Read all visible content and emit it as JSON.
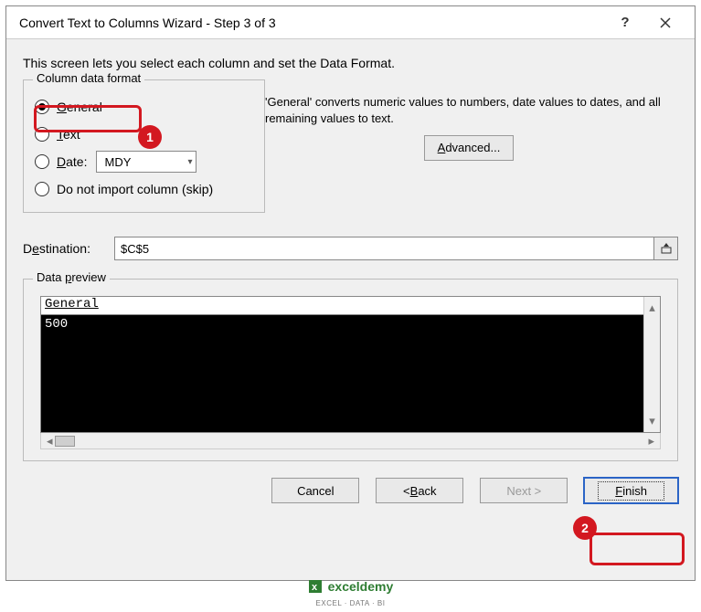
{
  "titlebar": {
    "title": "Convert Text to Columns Wizard - Step 3 of 3"
  },
  "instruction": "This screen lets you select each column and set the Data Format.",
  "format_group": {
    "label": "Column data format",
    "options": {
      "general": "General",
      "text": "Text",
      "date": "Date:",
      "skip": "Do not import column (skip)"
    },
    "date_value": "MDY",
    "description": "'General' converts numeric values to numbers, date values to dates, and all remaining values to text.",
    "advanced_label": "Advanced..."
  },
  "destination": {
    "label": "Destination:",
    "value": "$C$5"
  },
  "preview": {
    "label": "Data preview",
    "header": "General",
    "row": "500"
  },
  "buttons": {
    "cancel": "Cancel",
    "back": "< Back",
    "next": "Next >",
    "finish": "Finish"
  },
  "annotations": {
    "badge1": "1",
    "badge2": "2"
  },
  "branding": {
    "name": "exceldemy",
    "tagline": "EXCEL · DATA · BI"
  }
}
